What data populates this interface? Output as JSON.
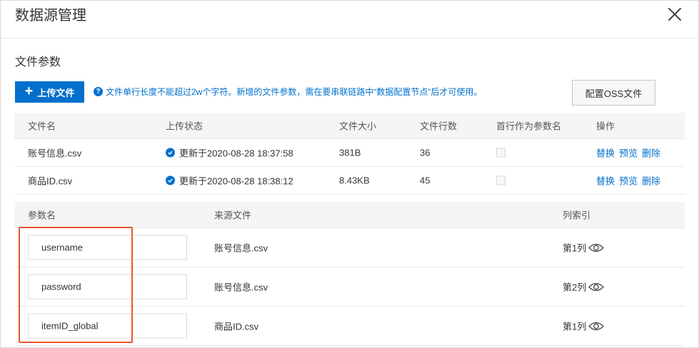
{
  "dialog": {
    "title": "数据源管理",
    "close_icon": "close-icon"
  },
  "section": {
    "title": "文件参数"
  },
  "toolbar": {
    "upload_label": "上传文件",
    "plus_glyph": "+",
    "help_glyph": "?",
    "hint_text": "文件单行长度不能超过2w个字符。新增的文件参数，需在要串联链路中“数据配置节点”后才可使用。",
    "oss_label": "配置OSS文件"
  },
  "file_table": {
    "headers": {
      "name": "文件名",
      "status": "上传状态",
      "size": "文件大小",
      "rows": "文件行数",
      "first_row": "首行作为参数名",
      "ops": "操作"
    },
    "rows": [
      {
        "name": "账号信息.csv",
        "status": "更新于2020-08-28 18:37:58",
        "size": "381B",
        "rows": "36",
        "first_row_checked": false,
        "op_replace": "替换",
        "op_preview": "预览",
        "op_delete": "删除"
      },
      {
        "name": "商品ID.csv",
        "status": "更新于2020-08-28 18:38:12",
        "size": "8.43KB",
        "rows": "45",
        "first_row_checked": false,
        "op_replace": "替换",
        "op_preview": "预览",
        "op_delete": "删除"
      }
    ]
  },
  "param_table": {
    "headers": {
      "param": "参数名",
      "source": "来源文件",
      "index": "列索引"
    },
    "rows": [
      {
        "param": "username",
        "source": "账号信息.csv",
        "index": "第1列"
      },
      {
        "param": "password",
        "source": "账号信息.csv",
        "index": "第2列"
      },
      {
        "param": "itemID_global",
        "source": "商品ID.csv",
        "index": "第1列"
      }
    ]
  },
  "colors": {
    "primary": "#0070cc",
    "highlight": "#e4572e",
    "header_bg": "#f5f5f5",
    "border": "#e8e8e8"
  }
}
